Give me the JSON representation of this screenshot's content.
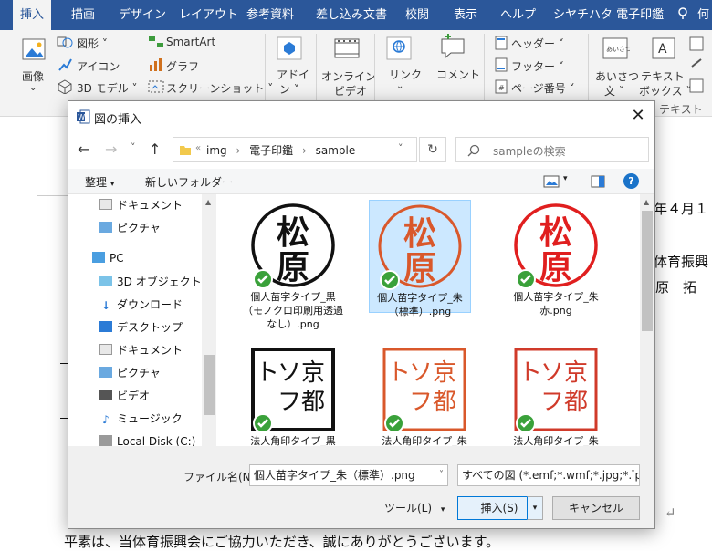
{
  "ribbon": {
    "tabs": [
      "挿入",
      "描画",
      "デザイン",
      "レイアウト",
      "参考資料",
      "差し込み文書",
      "校閲",
      "表示",
      "ヘルプ",
      "シヤチハタ 電子印鑑",
      "何"
    ],
    "picture_label": "画像",
    "shapes_label": "図形",
    "icons_label": "アイコン",
    "model3d_label": "3D モデル",
    "smartart_label": "SmartArt",
    "chart_label": "グラフ",
    "screenshot_label": "スクリーンショット",
    "addin_label_1": "アドイ",
    "addin_label_2": "ン",
    "online_video_1": "オンライン",
    "online_video_2": "ビデオ",
    "link_label": "リンク",
    "comment_label": "コメント",
    "header_label": "ヘッダー",
    "footer_label": "フッター",
    "page_number_label": "ページ番号",
    "greeting_1": "あいさつ",
    "greeting_2": "文",
    "textbox_1": "テキスト",
    "textbox_2": "ボックス",
    "text_group": "テキスト"
  },
  "document": {
    "date_fragment": "年４月１",
    "line_org": "体育振興",
    "line_name": "原　拓",
    "line_bottom": "平素は、当体育振興会にご協力いただき、誠にありがとうございます。"
  },
  "dialog": {
    "title": "図の挿入",
    "path": [
      "img",
      "電子印鑑",
      "sample"
    ],
    "search_placeholder": "sampleの検索",
    "organize": "整理",
    "new_folder": "新しいフォルダー",
    "nav_items": [
      "ドキュメント",
      "ピクチャ",
      "PC",
      "3D オブジェクト",
      "ダウンロード",
      "デスクトップ",
      "ドキュメント",
      "ピクチャ",
      "ビデオ",
      "ミュージック",
      "Local Disk (C:)"
    ],
    "files": [
      {
        "name": "個人苗字タイプ_黒（モノクロ印刷用透過なし）.png",
        "stamp_text": "松原",
        "color": "#111111"
      },
      {
        "name": "個人苗字タイプ_朱（標準）.png",
        "stamp_text": "松原",
        "color": "#d9582b"
      },
      {
        "name": "個人苗字タイプ_朱赤.png",
        "stamp_text": "松原",
        "color": "#e01f1f"
      },
      {
        "name": "法人角印タイプ_黒",
        "stamp_text": "京都ソフト",
        "color": "#111111"
      },
      {
        "name": "法人角印タイプ_朱",
        "stamp_text": "京都ソフト",
        "color": "#d9582b"
      },
      {
        "name": "法人角印タイプ_朱",
        "stamp_text": "京都ソフト",
        "color": "#d03a2a"
      }
    ],
    "file_name_label": "ファイル名(N):",
    "file_name_value": "個人苗字タイプ_朱（標準）.png",
    "filter_value": "すべての図 (*.emf;*.wmf;*.jpg;*.jp",
    "tools": "ツール(L)",
    "insert": "挿入(S)",
    "cancel": "キャンセル",
    "selected_index": 1
  },
  "colors": {
    "ribbon_blue": "#2b579a",
    "selection": "#cce8ff",
    "accent_button": "#0078d7"
  }
}
